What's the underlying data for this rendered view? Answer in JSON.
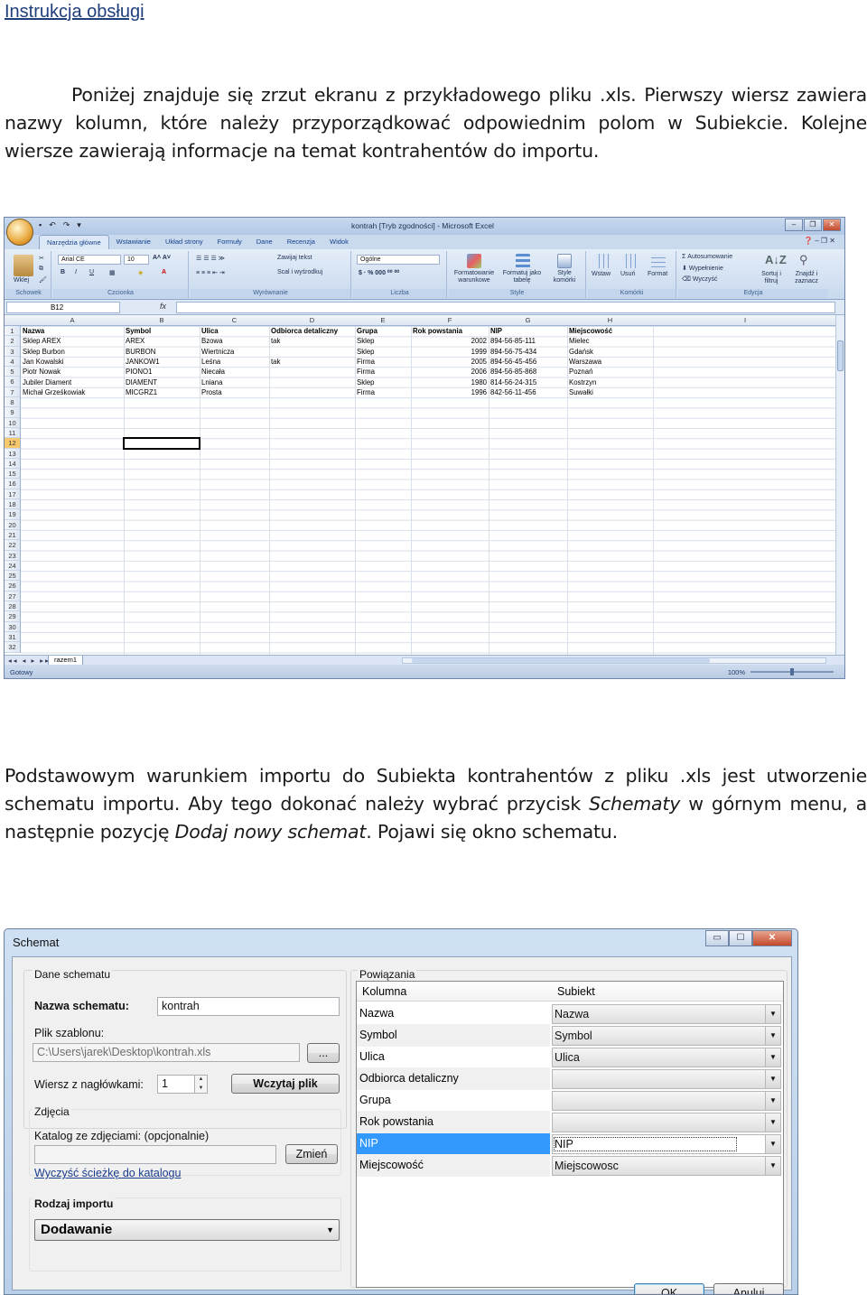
{
  "doc": {
    "title": "Instrukcja obsługi",
    "para1": "Poniżej znajduje się zrzut ekranu z przykładowego pliku .xls. Pierwszy wiersz zawiera nazwy kolumn, które należy przyporządkować odpowiednim polom w Subiekcie. Kolejne wiersze zawierają informacje na temat kontrahentów do importu.",
    "para2_a": "Podstawowym warunkiem importu do Subiekta kontrahentów z pliku .xls jest utworzenie schematu importu. Aby tego dokonać należy wybrać przycisk ",
    "para2_b": "Schematy",
    "para2_c": " w górnym menu, a następnie pozycję ",
    "para2_d": "Dodaj nowy schemat",
    "para2_e": ". Pojawi się okno schematu."
  },
  "excel": {
    "title": "kontrah  [Tryb zgodności] - Microsoft Excel",
    "tabs": [
      "Narzędzia główne",
      "Wstawianie",
      "Układ strony",
      "Formuły",
      "Dane",
      "Recenzja",
      "Widok"
    ],
    "ribbon": {
      "font_name": "Arial CE",
      "font_size": "10",
      "number_format": "Ogólne",
      "paste": "Wklej",
      "wrap": "Zawijaj tekst",
      "merge": "Scal i wyśrodkuj",
      "cond_format": "Formatowanie warunkowe",
      "format_table": "Formatuj jako tabelę",
      "cell_styles": "Style komórki",
      "insert": "Wstaw",
      "delete": "Usuń",
      "format": "Format",
      "autosum": "Autosumowanie",
      "fill": "Wypełnienie",
      "clear": "Wyczyść",
      "sort": "Sortuj i filtruj",
      "find": "Znajdź i zaznacz",
      "groups": [
        "Schowek",
        "Czcionka",
        "Wyrównanie",
        "Liczba",
        "Style",
        "Komórki",
        "Edycja"
      ]
    },
    "namebox": "B12",
    "fx": "fx",
    "columns": [
      "A",
      "B",
      "C",
      "D",
      "E",
      "F",
      "G",
      "H",
      "I"
    ],
    "rows": [
      [
        "Nazwa",
        "Symbol",
        "Ulica",
        "Odbiorca detaliczny",
        "Grupa",
        "Rok powstania",
        "NIP",
        "Miejscowość"
      ],
      [
        "Sklep AREX",
        "AREX",
        "Bzowa",
        "tak",
        "Sklep",
        "2002",
        "894-56-85-111",
        "Mielec"
      ],
      [
        "Sklep Burbon",
        "BURBON",
        "Wiertnicza",
        "",
        "Sklep",
        "1999",
        "894-56-75-434",
        "Gdańsk"
      ],
      [
        "Jan Kowalski",
        "JANKOW1",
        "Leśna",
        "tak",
        "Firma",
        "2005",
        "894-56-45-456",
        "Warszawa"
      ],
      [
        "Piotr Nowak",
        "PIONO1",
        "Niecała",
        "",
        "Firma",
        "2006",
        "894-56-85-868",
        "Poznań"
      ],
      [
        "Jubiler Diament",
        "DIAMENT",
        "Lniana",
        "",
        "Sklep",
        "1980",
        "814-56-24-315",
        "Kostrzyn"
      ],
      [
        "Michał Grześkowiak",
        "MICGRZ1",
        "Prosta",
        "",
        "Firma",
        "1996",
        "842-56-11-456",
        "Suwałki"
      ]
    ],
    "row_count": 32,
    "sheet_tab": "razem1",
    "status": "Gotowy",
    "zoom": "100%"
  },
  "dialog": {
    "title": "Schemat",
    "dane_label": "Dane schematu",
    "nazwa_label": "Nazwa schematu:",
    "nazwa_value": "kontrah",
    "plik_label": "Plik szablonu:",
    "plik_value": "C:\\Users\\jarek\\Desktop\\kontrah.xls",
    "browse": "...",
    "wiersz_label": "Wiersz z nagłówkami:",
    "wiersz_value": "1",
    "wczytaj": "Wczytaj plik",
    "zdjecia_label": "Zdjęcia",
    "katalog_label": "Katalog ze zdjęciami: (opcjonalnie)",
    "zmien": "Zmień",
    "wyczysc": "Wyczyść ścieżkę do katalogu",
    "rodzaj_label": "Rodzaj importu",
    "rodzaj_value": "Dodawanie",
    "powiazania_label": "Powiązania",
    "col_kolumna": "Kolumna",
    "col_subiekt": "Subiekt",
    "mappings": [
      {
        "kolumna": "Nazwa",
        "subiekt": "Nazwa"
      },
      {
        "kolumna": "Symbol",
        "subiekt": "Symbol"
      },
      {
        "kolumna": "Ulica",
        "subiekt": "Ulica"
      },
      {
        "kolumna": "Odbiorca detaliczny",
        "subiekt": ""
      },
      {
        "kolumna": "Grupa",
        "subiekt": ""
      },
      {
        "kolumna": "Rok powstania",
        "subiekt": ""
      },
      {
        "kolumna": "NIP",
        "subiekt": "NIP"
      },
      {
        "kolumna": "Miejscowość",
        "subiekt": "Miejscowosc"
      }
    ],
    "selected_row": 6,
    "ok": "OK",
    "anuluj": "Anuluj"
  }
}
